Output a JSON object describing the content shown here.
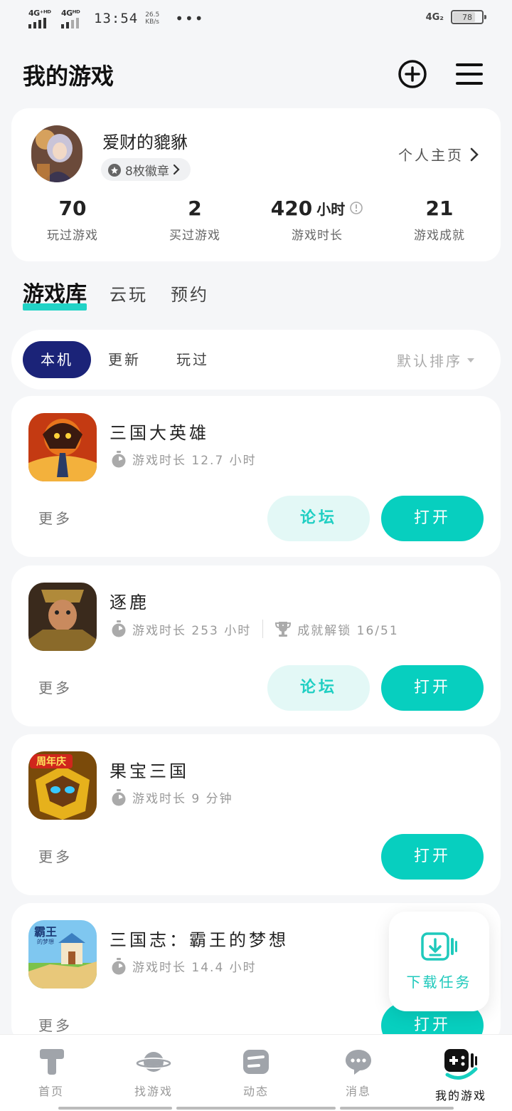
{
  "status_bar": {
    "net1": "4G⁺ᴴᴰ",
    "net2": "4Gᴴᴰ",
    "time": "13:54",
    "speed_value": "26.5",
    "speed_unit": "KB/s",
    "dots": "•••",
    "net_right": "4G₂",
    "battery": "78",
    "battery_level": 0.78
  },
  "header": {
    "title": "我的游戏"
  },
  "profile": {
    "username": "爱财的貔貅",
    "badges": "8枚徽章",
    "homepage": "个人主页",
    "stats": [
      {
        "value": "70",
        "unit": "",
        "label": "玩过游戏"
      },
      {
        "value": "2",
        "unit": "",
        "label": "买过游戏"
      },
      {
        "value": "420",
        "unit": "小时",
        "label": "游戏时长"
      },
      {
        "value": "21",
        "unit": "",
        "label": "游戏成就"
      }
    ]
  },
  "tabs": [
    "游戏库",
    "云玩",
    "预约"
  ],
  "filters": {
    "chips": [
      "本机",
      "更新",
      "玩过"
    ],
    "sort": "默认排序"
  },
  "games": [
    {
      "name": "三国大英雄",
      "playtime": "游戏时长 12.7 小时",
      "achievement": "",
      "more": "更多",
      "forum": "论坛",
      "open": "打开"
    },
    {
      "name": "逐鹿",
      "playtime": "游戏时长 253 小时",
      "achievement": "成就解锁 16/51",
      "more": "更多",
      "forum": "论坛",
      "open": "打开"
    },
    {
      "name": "果宝三国",
      "playtime": "游戏时长 9 分钟",
      "achievement": "",
      "more": "更多",
      "forum": "",
      "open": "打开"
    },
    {
      "name": "三国志：霸王的梦想",
      "playtime": "游戏时长 14.4 小时",
      "achievement": "",
      "more": "更多",
      "forum": "",
      "open": "打开"
    }
  ],
  "game_icon_text": {
    "g3": "周年庆",
    "g4_title": "霸王",
    "g4_sub": "的梦想"
  },
  "download": {
    "label": "下载任务"
  },
  "bottom_nav": [
    {
      "label": "首页",
      "icon": "home-t-icon"
    },
    {
      "label": "找游戏",
      "icon": "planet-icon"
    },
    {
      "label": "动态",
      "icon": "feed-icon"
    },
    {
      "label": "消息",
      "icon": "chat-bubble-icon"
    },
    {
      "label": "我的游戏",
      "icon": "gamepad-icon"
    }
  ],
  "colors": {
    "accent": "#07cfbf",
    "accent_light": "#e3f8f6",
    "chip_active": "#1b2378"
  }
}
